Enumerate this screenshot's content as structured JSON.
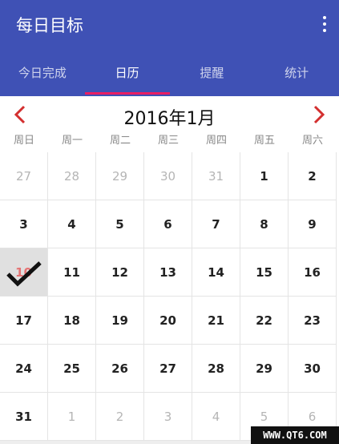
{
  "app": {
    "title": "每日目标"
  },
  "tabs": [
    {
      "label": "今日完成",
      "active": false
    },
    {
      "label": "日历",
      "active": true
    },
    {
      "label": "提醒",
      "active": false
    },
    {
      "label": "统计",
      "active": false
    }
  ],
  "calendar": {
    "month_title": "2016年1月",
    "weekdays": [
      "周日",
      "周一",
      "周二",
      "周三",
      "周四",
      "周五",
      "周六"
    ],
    "days": [
      {
        "d": "27",
        "current": false
      },
      {
        "d": "28",
        "current": false
      },
      {
        "d": "29",
        "current": false
      },
      {
        "d": "30",
        "current": false
      },
      {
        "d": "31",
        "current": false
      },
      {
        "d": "1",
        "current": true
      },
      {
        "d": "2",
        "current": true
      },
      {
        "d": "3",
        "current": true
      },
      {
        "d": "4",
        "current": true
      },
      {
        "d": "5",
        "current": true
      },
      {
        "d": "6",
        "current": true
      },
      {
        "d": "7",
        "current": true
      },
      {
        "d": "8",
        "current": true
      },
      {
        "d": "9",
        "current": true
      },
      {
        "d": "10",
        "current": true,
        "selected": true,
        "checked": true
      },
      {
        "d": "11",
        "current": true
      },
      {
        "d": "12",
        "current": true
      },
      {
        "d": "13",
        "current": true
      },
      {
        "d": "14",
        "current": true
      },
      {
        "d": "15",
        "current": true
      },
      {
        "d": "16",
        "current": true
      },
      {
        "d": "17",
        "current": true
      },
      {
        "d": "18",
        "current": true
      },
      {
        "d": "19",
        "current": true
      },
      {
        "d": "20",
        "current": true
      },
      {
        "d": "21",
        "current": true
      },
      {
        "d": "22",
        "current": true
      },
      {
        "d": "23",
        "current": true
      },
      {
        "d": "24",
        "current": true
      },
      {
        "d": "25",
        "current": true
      },
      {
        "d": "26",
        "current": true
      },
      {
        "d": "27",
        "current": true
      },
      {
        "d": "28",
        "current": true
      },
      {
        "d": "29",
        "current": true
      },
      {
        "d": "30",
        "current": true
      },
      {
        "d": "31",
        "current": true
      },
      {
        "d": "1",
        "current": false
      },
      {
        "d": "2",
        "current": false
      },
      {
        "d": "3",
        "current": false
      },
      {
        "d": "4",
        "current": false
      },
      {
        "d": "5",
        "current": false
      },
      {
        "d": "6",
        "current": false
      }
    ]
  },
  "watermark": "WWW.QT6.COM",
  "colors": {
    "appbar": "#3f51b5",
    "tab_indicator": "#e91e63",
    "nav_arrow": "#d32f2f",
    "selected_day_text": "#e57373",
    "selected_cell": "#e0e0e0"
  },
  "icons": {
    "more": "more-vert-icon",
    "prev": "chevron-left-icon",
    "next": "chevron-right-icon",
    "check": "checkmark-icon"
  }
}
